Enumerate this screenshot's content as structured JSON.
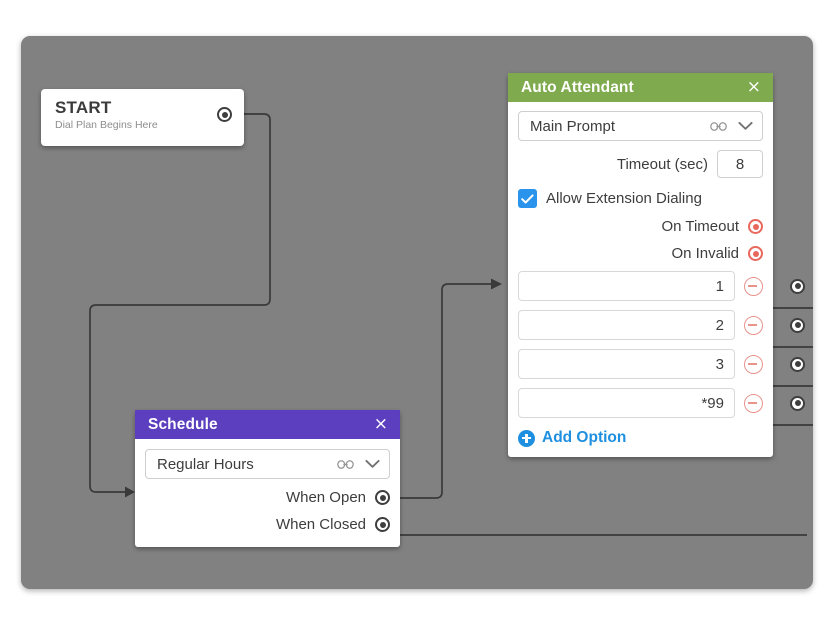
{
  "canvas": {
    "background_color": "#818181",
    "wire_color": "#3a3a3a"
  },
  "start_node": {
    "title": "START",
    "subtitle": "Dial Plan Begins Here",
    "output_port_name": "start-output-port"
  },
  "auto_attendant": {
    "header_color": "#7faa4e",
    "title": "Auto Attendant",
    "close_label": "×",
    "prompt_select": {
      "value": "Main Prompt",
      "link_icon": "chain-link-icon",
      "chevron_icon": "chevron-down-icon"
    },
    "timeout": {
      "label": "Timeout (sec)",
      "value": "8"
    },
    "allow_extension_dialing": {
      "label": "Allow Extension Dialing",
      "checked": true,
      "check_glyph": "✓",
      "accent_color": "#2a93ec"
    },
    "event_ports": [
      {
        "label": "On Timeout",
        "port_color": "#e8685c"
      },
      {
        "label": "On Invalid",
        "port_color": "#e8685c"
      }
    ],
    "options": [
      {
        "value": "1",
        "remove_icon": "minus-circle-icon"
      },
      {
        "value": "2",
        "remove_icon": "minus-circle-icon"
      },
      {
        "value": "3",
        "remove_icon": "minus-circle-icon"
      },
      {
        "value": "*99",
        "remove_icon": "minus-circle-icon"
      }
    ],
    "add_option": {
      "label": "Add Option",
      "icon": "plus-circle-icon",
      "color": "#1f8fe0"
    }
  },
  "schedule": {
    "header_color": "#5b3fbe",
    "title": "Schedule",
    "close_label": "×",
    "hours_select": {
      "value": "Regular Hours",
      "link_icon": "chain-link-icon",
      "chevron_icon": "chevron-down-icon"
    },
    "branches": [
      {
        "label": "When Open"
      },
      {
        "label": "When Closed"
      }
    ]
  }
}
